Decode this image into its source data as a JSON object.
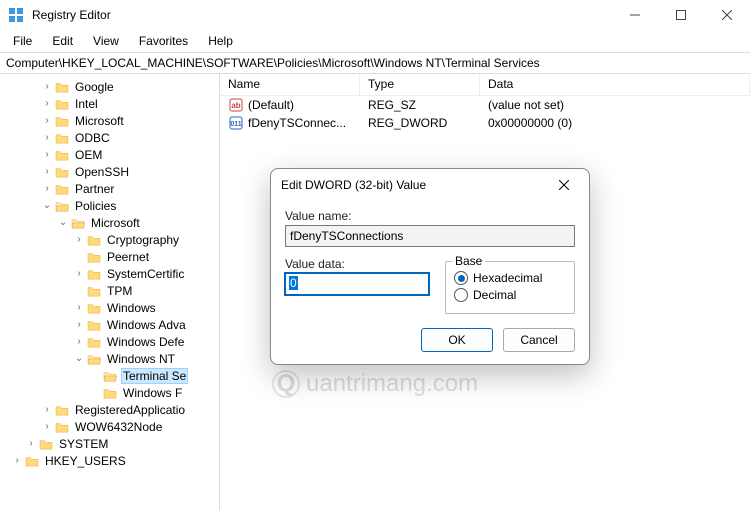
{
  "window": {
    "title": "Registry Editor",
    "menu": [
      "File",
      "Edit",
      "View",
      "Favorites",
      "Help"
    ]
  },
  "address": "Computer\\HKEY_LOCAL_MACHINE\\SOFTWARE\\Policies\\Microsoft\\Windows NT\\Terminal Services",
  "tree": [
    {
      "indent": 40,
      "chev": ">",
      "label": "Google"
    },
    {
      "indent": 40,
      "chev": ">",
      "label": "Intel"
    },
    {
      "indent": 40,
      "chev": ">",
      "label": "Microsoft"
    },
    {
      "indent": 40,
      "chev": ">",
      "label": "ODBC"
    },
    {
      "indent": 40,
      "chev": ">",
      "label": "OEM"
    },
    {
      "indent": 40,
      "chev": ">",
      "label": "OpenSSH"
    },
    {
      "indent": 40,
      "chev": ">",
      "label": "Partner"
    },
    {
      "indent": 40,
      "chev": "v",
      "label": "Policies",
      "open": true
    },
    {
      "indent": 56,
      "chev": "v",
      "label": "Microsoft",
      "open": true
    },
    {
      "indent": 72,
      "chev": ">",
      "label": "Cryptography"
    },
    {
      "indent": 72,
      "chev": "",
      "label": "Peernet"
    },
    {
      "indent": 72,
      "chev": ">",
      "label": "SystemCertific"
    },
    {
      "indent": 72,
      "chev": "",
      "label": "TPM"
    },
    {
      "indent": 72,
      "chev": ">",
      "label": "Windows"
    },
    {
      "indent": 72,
      "chev": ">",
      "label": "Windows Adva"
    },
    {
      "indent": 72,
      "chev": ">",
      "label": "Windows Defe"
    },
    {
      "indent": 72,
      "chev": "v",
      "label": "Windows NT",
      "open": true
    },
    {
      "indent": 88,
      "chev": "",
      "label": "Terminal Se",
      "selected": true,
      "open": true
    },
    {
      "indent": 88,
      "chev": "",
      "label": "Windows F"
    },
    {
      "indent": 40,
      "chev": ">",
      "label": "RegisteredApplicatio"
    },
    {
      "indent": 40,
      "chev": ">",
      "label": "WOW6432Node"
    },
    {
      "indent": 24,
      "chev": ">",
      "label": "SYSTEM"
    },
    {
      "indent": 10,
      "chev": ">",
      "label": "HKEY_USERS"
    }
  ],
  "list": {
    "columns": [
      "Name",
      "Type",
      "Data"
    ],
    "rows": [
      {
        "icon": "ab",
        "name": "(Default)",
        "type": "REG_SZ",
        "data": "(value not set)"
      },
      {
        "icon": "dw",
        "name": "fDenyTSConnec...",
        "type": "REG_DWORD",
        "data": "0x00000000 (0)"
      }
    ]
  },
  "dialog": {
    "title": "Edit DWORD (32-bit) Value",
    "value_name_label": "Value name:",
    "value_name": "fDenyTSConnections",
    "value_data_label": "Value data:",
    "value_data": "0",
    "base_label": "Base",
    "hex_label": "Hexadecimal",
    "dec_label": "Decimal",
    "ok": "OK",
    "cancel": "Cancel"
  },
  "watermark": "uantrimang.com"
}
